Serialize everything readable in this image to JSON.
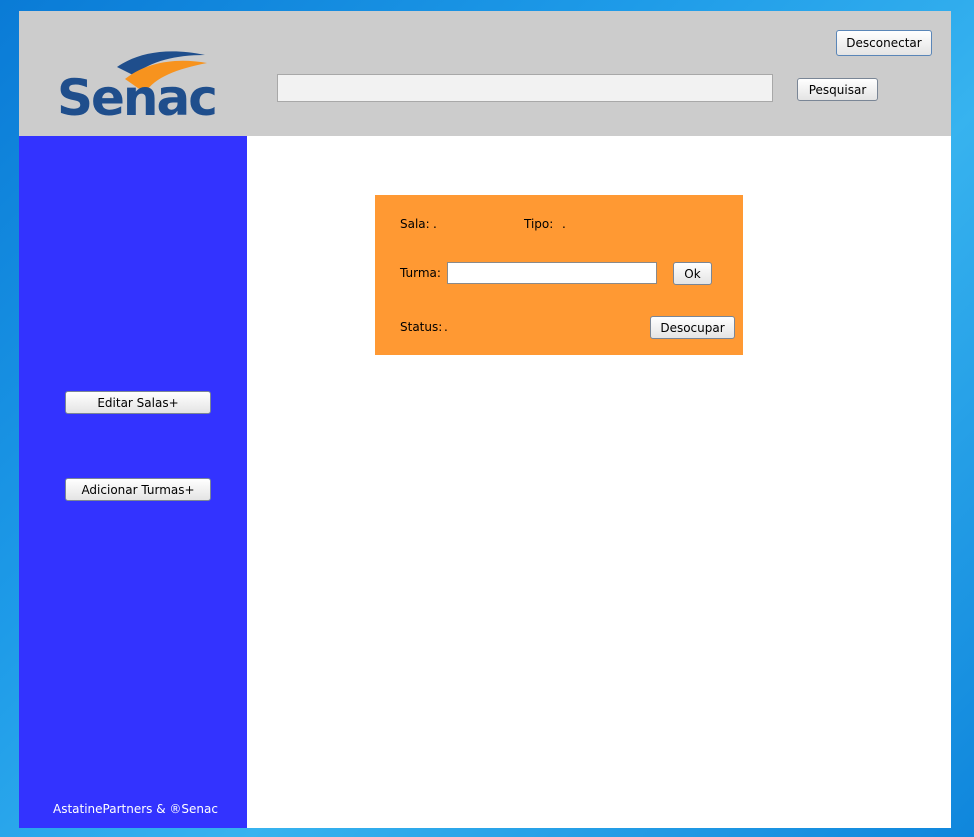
{
  "header": {
    "logo_text": "Senac",
    "search": {
      "value": "",
      "placeholder": ""
    },
    "search_button": "Pesquisar",
    "disconnect_button": "Desconectar"
  },
  "sidebar": {
    "buttons": [
      {
        "label": "Editar Salas+"
      },
      {
        "label": "Adicionar Turmas+"
      }
    ],
    "footer": "AstatinePartners & ®Senac"
  },
  "room_card": {
    "sala_label": "Sala:",
    "sala_value": ".",
    "tipo_label": "Tipo:",
    "tipo_value": ".",
    "turma_label": "Turma:",
    "turma_value": "",
    "ok_button": "Ok",
    "status_label": "Status:",
    "status_value": ".",
    "release_button": "Desocupar"
  },
  "colors": {
    "header_bg": "#cccccc",
    "sidebar_bg": "#3333ff",
    "card_bg": "#ff9933",
    "logo_blue": "#1f4e8c",
    "logo_orange": "#f7931e"
  }
}
